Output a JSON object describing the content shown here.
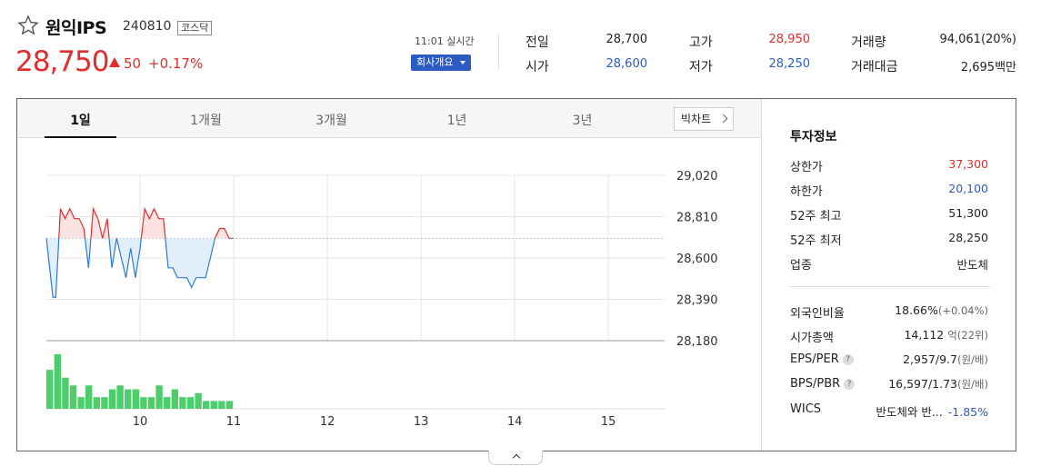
{
  "stock": {
    "name": "원익IPS",
    "code": "240810",
    "market": "코스닥",
    "price": "28,750",
    "change": "50",
    "change_rate": "+0.17%",
    "color_up": "#e22d2d",
    "color_down": "#2d5bc4"
  },
  "realtime": {
    "label": "11:01 실시간",
    "company_button": "회사개요"
  },
  "quote": {
    "prev_close_label": "전일",
    "prev_close": "28,700",
    "open_label": "시가",
    "open": "28,600",
    "high_label": "고가",
    "high": "28,950",
    "low_label": "저가",
    "low": "28,250",
    "volume_label": "거래량",
    "volume": "94,061(20%)",
    "amount_label": "거래대금",
    "amount": "2,695백만"
  },
  "tabs": [
    "1일",
    "1개월",
    "3개월",
    "1년",
    "3년"
  ],
  "big_chart_button": "빅차트",
  "info": {
    "title": "투자정보",
    "upper_limit_label": "상한가",
    "upper_limit": "37,300",
    "lower_limit_label": "하한가",
    "lower_limit": "20,100",
    "w52_high_label": "52주 최고",
    "w52_high": "51,300",
    "w52_low_label": "52주 최저",
    "w52_low": "28,250",
    "sector_label": "업종",
    "sector": "반도체",
    "foreign_label": "외국인비율",
    "foreign": "18.66%",
    "foreign_change": "(+0.04%)",
    "mktcap_label": "시가총액",
    "mktcap": "14,112",
    "mktcap_unit": "억(22위)",
    "eps_per_label": "EPS/PER",
    "eps_per": "2,957/9.7",
    "eps_per_unit": "(원/배)",
    "bps_pbr_label": "BPS/PBR",
    "bps_pbr": "16,597/1.73",
    "bps_pbr_unit": "(원/배)",
    "wics_label": "WICS",
    "wics": "반도체와 반...",
    "wics_change": "-1.85%"
  },
  "chart_data": {
    "type": "line",
    "y_ticks": [
      "29,020",
      "28,810",
      "28,600",
      "28,390",
      "28,180"
    ],
    "x_ticks": [
      "10",
      "11",
      "12",
      "13",
      "14",
      "15"
    ],
    "ylim": [
      28180,
      29020
    ],
    "xlim": [
      9.0,
      15.6
    ],
    "baseline": 28700,
    "grid": true,
    "x": [
      9.0,
      9.07,
      9.1,
      9.15,
      9.2,
      9.25,
      9.3,
      9.35,
      9.4,
      9.45,
      9.5,
      9.55,
      9.6,
      9.65,
      9.7,
      9.75,
      9.8,
      9.85,
      9.9,
      9.95,
      10.0,
      10.05,
      10.1,
      10.15,
      10.2,
      10.25,
      10.3,
      10.35,
      10.4,
      10.45,
      10.5,
      10.55,
      10.6,
      10.65,
      10.7,
      10.75,
      10.8,
      10.85,
      10.9,
      10.95,
      11.0
    ],
    "values": [
      28700,
      28400,
      28400,
      28850,
      28800,
      28850,
      28800,
      28800,
      28750,
      28550,
      28850,
      28800,
      28700,
      28800,
      28550,
      28700,
      28600,
      28500,
      28650,
      28500,
      28650,
      28850,
      28800,
      28850,
      28800,
      28800,
      28550,
      28550,
      28500,
      28500,
      28500,
      28450,
      28500,
      28500,
      28500,
      28600,
      28700,
      28750,
      28750,
      28700,
      28700
    ],
    "volume": [
      10,
      14,
      8,
      6,
      3,
      6,
      3,
      3,
      5,
      6,
      5,
      5,
      3,
      3,
      6,
      3,
      5,
      3,
      3,
      4,
      2,
      2,
      2,
      2
    ]
  }
}
